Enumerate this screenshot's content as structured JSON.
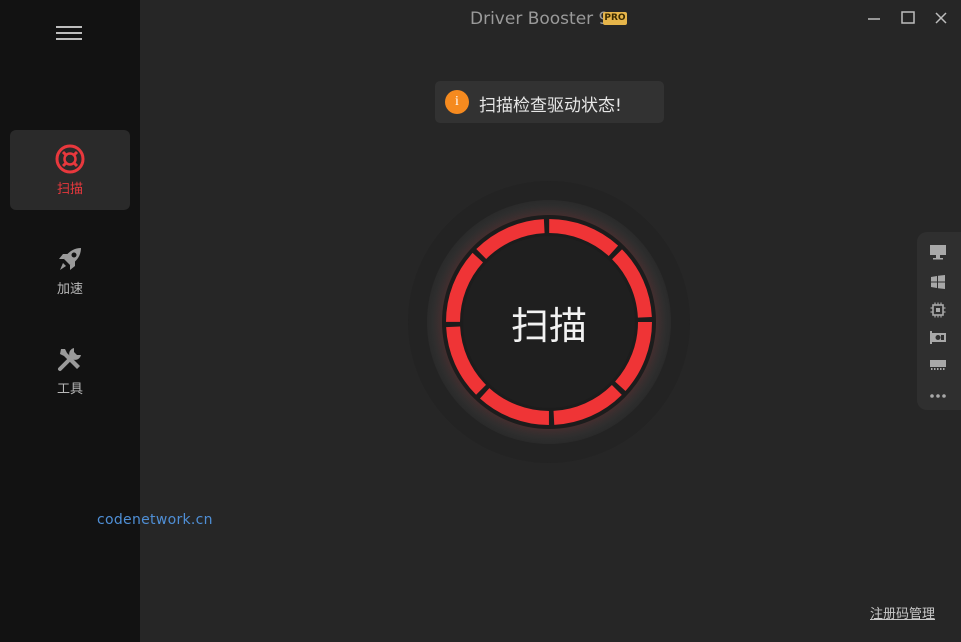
{
  "app": {
    "title": "Driver Booster 9",
    "badge": "PRO"
  },
  "sidebar": {
    "items": [
      {
        "label": "扫描",
        "icon": "lifebuoy-icon",
        "active": true
      },
      {
        "label": "加速",
        "icon": "rocket-icon",
        "active": false
      },
      {
        "label": "工具",
        "icon": "tools-icon",
        "active": false
      }
    ],
    "watermark": "codenetwork.cn"
  },
  "main": {
    "notice_icon_text": "i",
    "notice_text": "扫描检查驱动状态!",
    "scan_label": "扫描",
    "register_link": "注册码管理"
  },
  "side_panel": {
    "icons": [
      "monitor-icon",
      "windows-icon",
      "cpu-icon",
      "graphics-card-icon",
      "memory-icon",
      "more-icon"
    ]
  },
  "colors": {
    "accent": "#e8383d",
    "notice": "#f58a1f",
    "pro_badge": "#e6b54a",
    "watermark": "#4f8fd6"
  }
}
